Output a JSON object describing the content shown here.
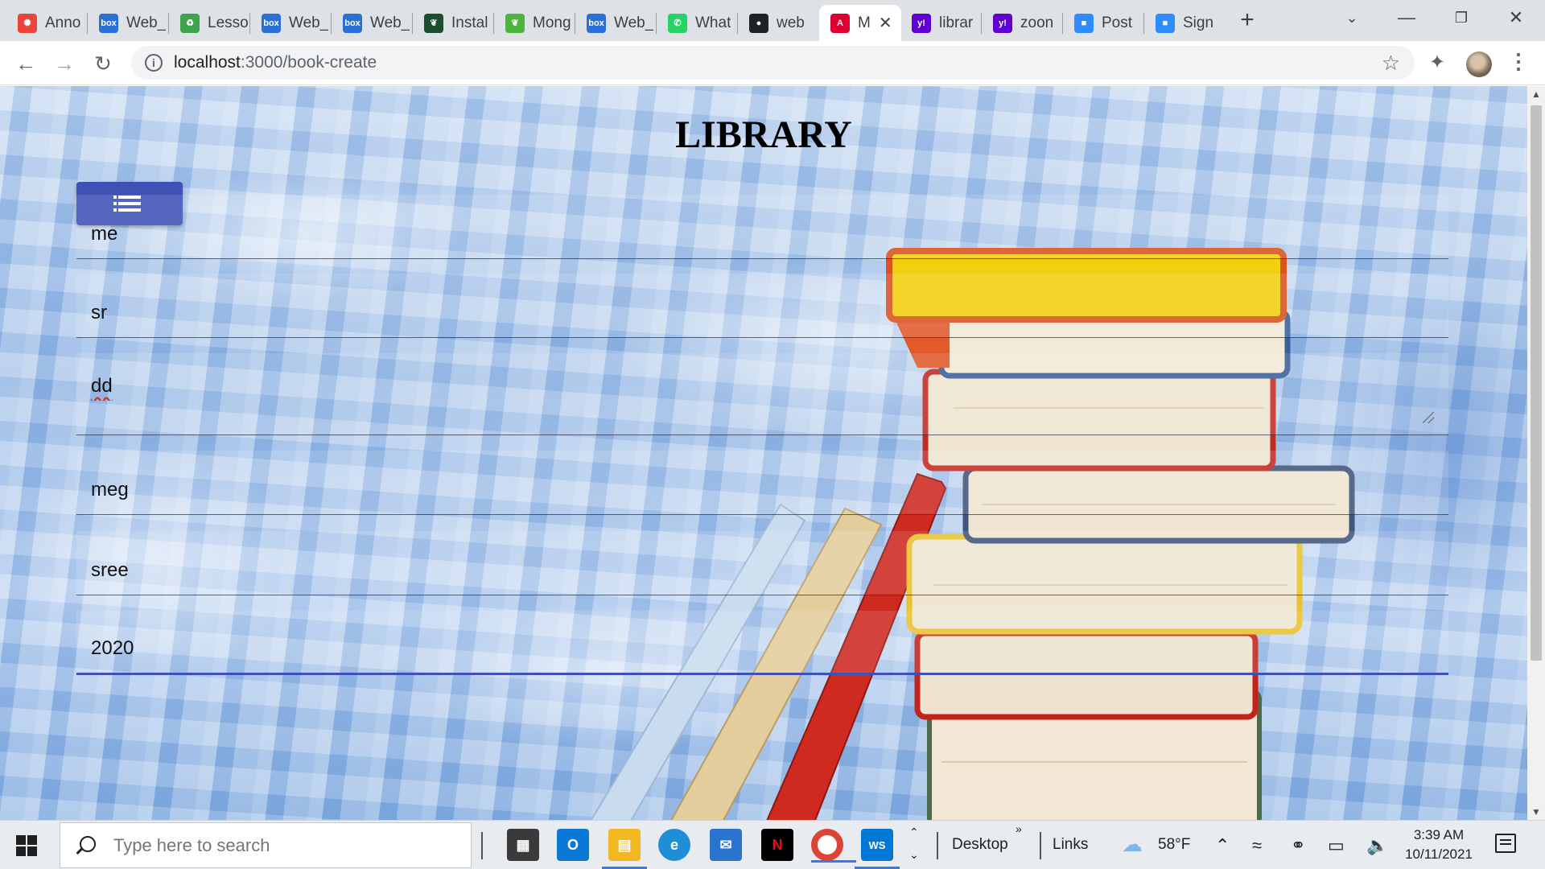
{
  "browser": {
    "tabs": [
      {
        "title": "Anno",
        "icon": "anno-icon",
        "color": "#e8453c"
      },
      {
        "title": "Web_",
        "icon": "box-icon",
        "color": "#2a6fd6"
      },
      {
        "title": "Lesso",
        "icon": "recycle-icon",
        "color": "#3fa34d"
      },
      {
        "title": "Web_",
        "icon": "box-icon",
        "color": "#2a6fd6"
      },
      {
        "title": "Web_",
        "icon": "box-icon",
        "color": "#2a6fd6"
      },
      {
        "title": "Instal",
        "icon": "mongodb-leaf-icon",
        "color": "#1b4d2e"
      },
      {
        "title": "Mong",
        "icon": "mongodb-leaf-icon",
        "color": "#4db33d"
      },
      {
        "title": "Web_",
        "icon": "box-icon",
        "color": "#2a6fd6"
      },
      {
        "title": "What",
        "icon": "whatsapp-icon",
        "color": "#25d366"
      },
      {
        "title": "web",
        "icon": "github-icon",
        "color": "#202124"
      },
      {
        "title": "M",
        "icon": "angular-icon",
        "color": "#dd0031",
        "active": true
      },
      {
        "title": "librar",
        "icon": "yahoo-icon",
        "color": "#6001d2"
      },
      {
        "title": "zoon",
        "icon": "yahoo-icon",
        "color": "#6001d2"
      },
      {
        "title": "Post",
        "icon": "zoom-icon",
        "color": "#2d8cff"
      },
      {
        "title": "Sign",
        "icon": "zoom-icon",
        "color": "#2d8cff"
      }
    ],
    "new_tab": "+",
    "url_host": "localhost",
    "url_path": ":3000/book-create"
  },
  "page": {
    "title": "LIBRARY",
    "accent_color": "#3f51b5",
    "fields": {
      "f1": "me",
      "f2": "sr",
      "f3": "dd",
      "f4": "meg",
      "f5": "sree",
      "f6": "2020"
    }
  },
  "taskbar": {
    "search_placeholder": "Type here to search",
    "desktop_label": "Desktop",
    "links_label": "Links",
    "weather": "58°F",
    "time": "3:39 AM",
    "date": "10/11/2021"
  }
}
